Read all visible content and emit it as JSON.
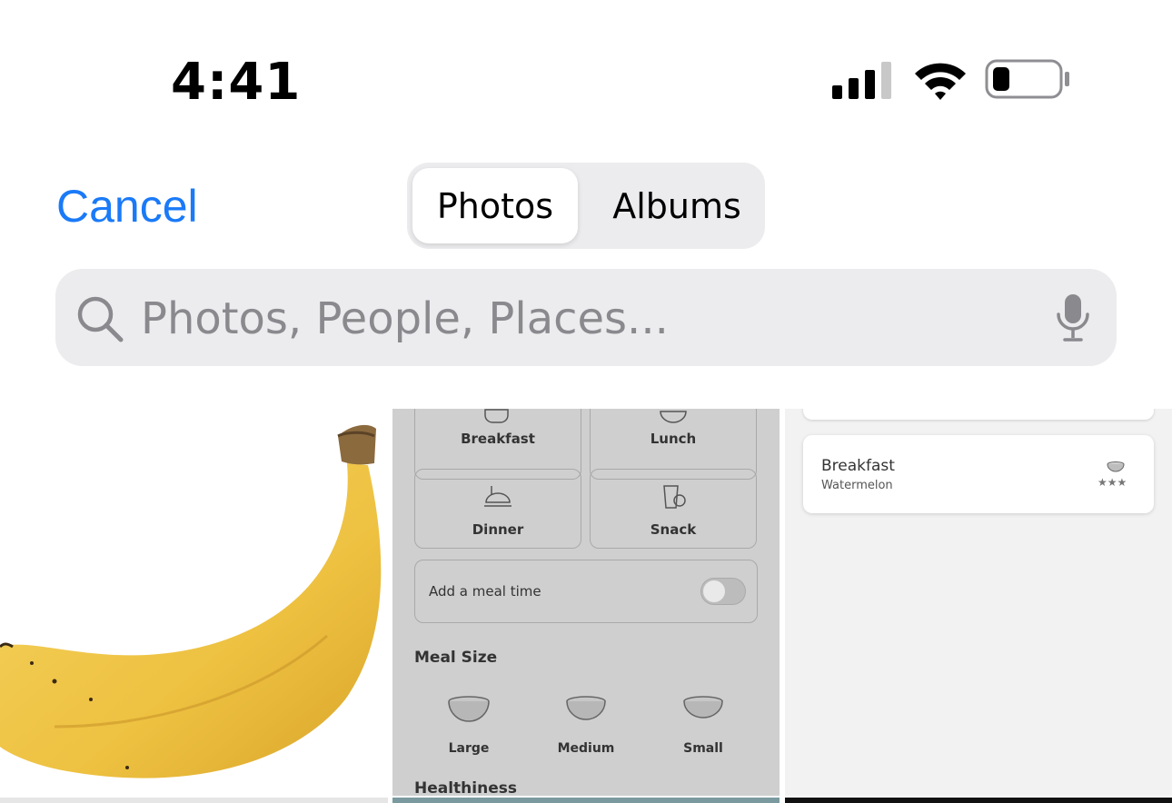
{
  "status_bar": {
    "time": "4:41",
    "icons": [
      "cellular-signal-icon",
      "wifi-icon",
      "battery-low-icon"
    ]
  },
  "nav": {
    "cancel_label": "Cancel",
    "segments": [
      {
        "label": "Photos",
        "selected": true
      },
      {
        "label": "Albums",
        "selected": false
      }
    ]
  },
  "search": {
    "placeholder": "Photos, People, Places..."
  },
  "colors": {
    "accent": "#1a7af8",
    "search_bg": "#ececee",
    "battery_level_fraction": 0.15
  },
  "grid": {
    "photo1": {
      "subject": "banana-image"
    },
    "photo2": {
      "meal_tiles": [
        "Breakfast",
        "Lunch",
        "Dinner",
        "Snack"
      ],
      "add_meal_label": "Add a meal time",
      "add_meal_toggle_on": false,
      "meal_size_title": "Meal Size",
      "sizes": [
        "Large",
        "Medium",
        "Small"
      ],
      "healthiness_title": "Healthiness"
    },
    "photo3": {
      "entry_title": "Breakfast",
      "entry_subtitle": "Watermelon",
      "rating_stars": 3
    }
  }
}
